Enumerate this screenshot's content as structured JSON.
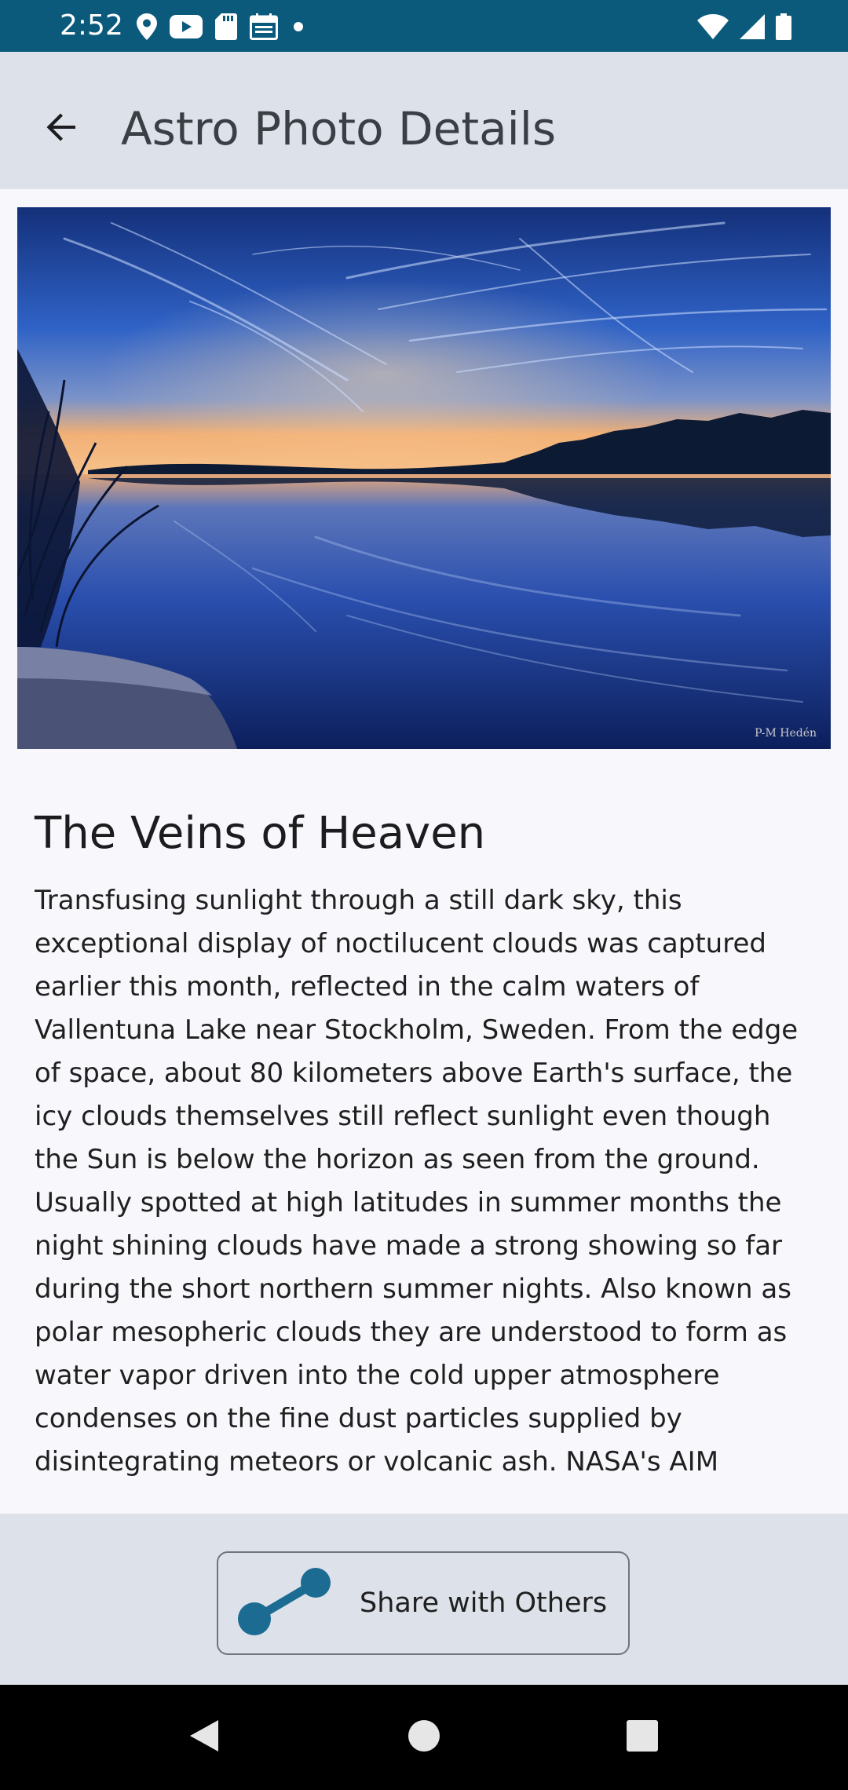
{
  "status_bar": {
    "time": "2:52",
    "left_icons": [
      "location-icon",
      "youtube-icon",
      "sd-card-icon",
      "calendar-icon",
      "dot-icon"
    ],
    "right_icons": [
      "wifi-icon",
      "signal-icon",
      "battery-icon"
    ]
  },
  "app_bar": {
    "title": "Astro Photo Details",
    "back_icon": "arrow-back-icon"
  },
  "photo": {
    "credit": "P-M Hedén"
  },
  "article": {
    "title": "The Veins of Heaven",
    "body": "Transfusing sunlight through a still dark sky, this exceptional display of noctilucent clouds was captured earlier this month, reflected in the calm waters of Vallentuna Lake near Stockholm, Sweden. From the edge of space, about 80 kilometers above Earth's surface, the icy clouds themselves still reflect sunlight even though the Sun is below the horizon as seen from the ground. Usually spotted at high latitudes in summer months the night shining clouds have made a strong showing so far during the short northern summer nights. Also known as polar mesopheric clouds they are understood to form as water vapor driven into the cold upper atmosphere condenses on the fine dust particles supplied by disintegrating meteors or volcanic ash. NASA's AIM"
  },
  "actions": {
    "share_label": "Share with Others",
    "share_icon": "share-icon"
  },
  "nav_bar": {
    "buttons": [
      "back-nav-icon",
      "home-nav-icon",
      "recents-nav-icon"
    ]
  },
  "colors": {
    "status_bar": "#0b5a7c",
    "app_bar": "#dde2ea",
    "accent": "#1c6b93",
    "background": "#f8f8fc"
  }
}
